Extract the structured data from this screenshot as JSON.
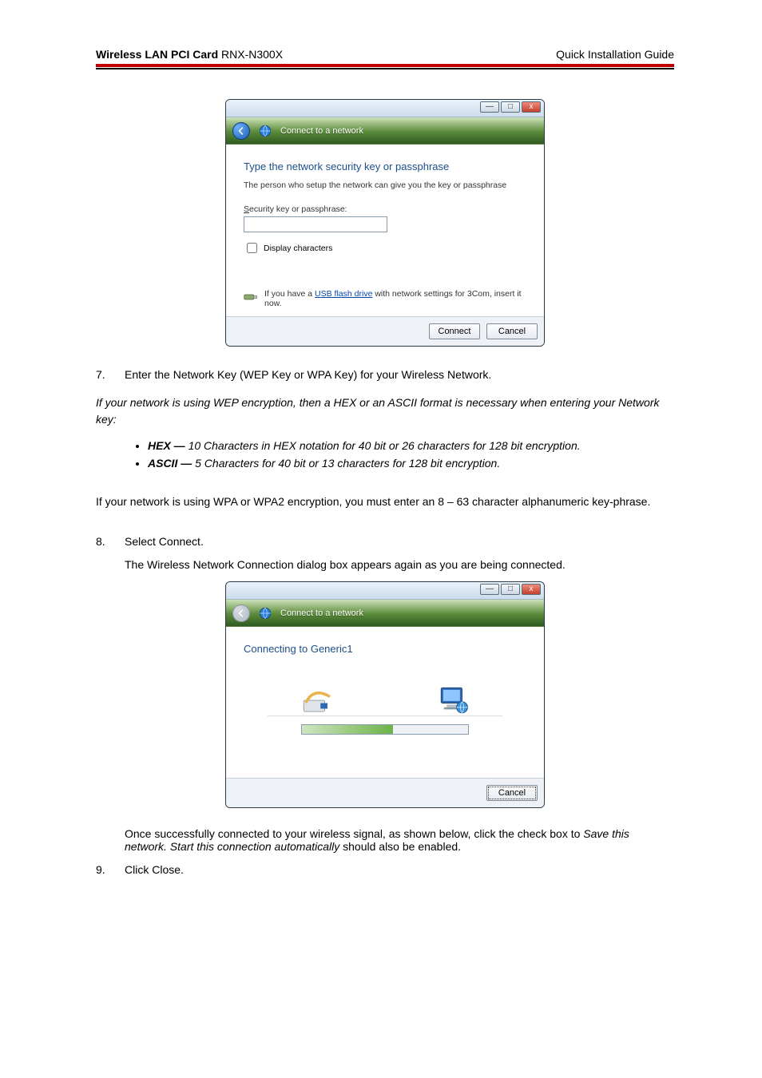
{
  "header": {
    "product_bold": "Wireless LAN PCI Card",
    "product_model": " RNX-N300X",
    "right": "Quick Installation Guide"
  },
  "shot1": {
    "window_min": "—",
    "window_max": "□",
    "window_close": "x",
    "back_icon": "back-arrow",
    "bc_icon": "network-globe-icon",
    "breadcrumb": "Connect to a network",
    "caption": "Type the network security key or passphrase",
    "subtext": "The person who setup the network can give you the key or passphrase",
    "field_label_pre": "S",
    "field_label_rest": "ecurity key or passphrase:",
    "display_chars_pre": "D",
    "display_chars_rest": "isplay characters",
    "usb_pre": "If you have a ",
    "usb_link": "USB flash drive",
    "usb_post": " with network settings for 3Com, insert it now.",
    "btn_connect": "Connect",
    "btn_cancel": "Cancel"
  },
  "steps": {
    "s7_num": "7.",
    "s7_text": "Enter the Network Key (WEP Key or WPA Key) for your Wireless Network.",
    "wep_note": "If your network is using WEP encryption, then a HEX or an ASCII format is necessary when entering your Network key:",
    "bullet_hex_lead": "HEX —",
    "bullet_hex_rest": " 10 Characters in HEX notation for 40 bit or 26 characters for 128 bit encryption.",
    "bullet_ascii_lead": "ASCII —",
    "bullet_ascii_rest": " 5 Characters for 40 bit or 13 characters for 128 bit encryption.",
    "wpa_note": "If your network is using WPA or WPA2 encryption, you must enter an 8 – 63 character alphanumeric key-phrase.",
    "s8_num": "8.",
    "s8_text": "Select Connect.",
    "s8_follow": "The Wireless Network Connection dialog box appears again as you are being connected.",
    "save_pre": "Once successfully connected to your wireless signal, as shown below, click the check box to ",
    "save_italic": "Save this network. Start this connection automatically",
    "save_post": " should also be enabled.",
    "s9_num": "9.",
    "s9_text": "Click Close."
  },
  "shot2": {
    "window_min": "—",
    "window_max": "□",
    "window_close": "x",
    "bc_icon": "network-globe-icon",
    "breadcrumb": "Connect to a network",
    "caption": "Connecting to Generic1",
    "btn_cancel": "Cancel"
  }
}
